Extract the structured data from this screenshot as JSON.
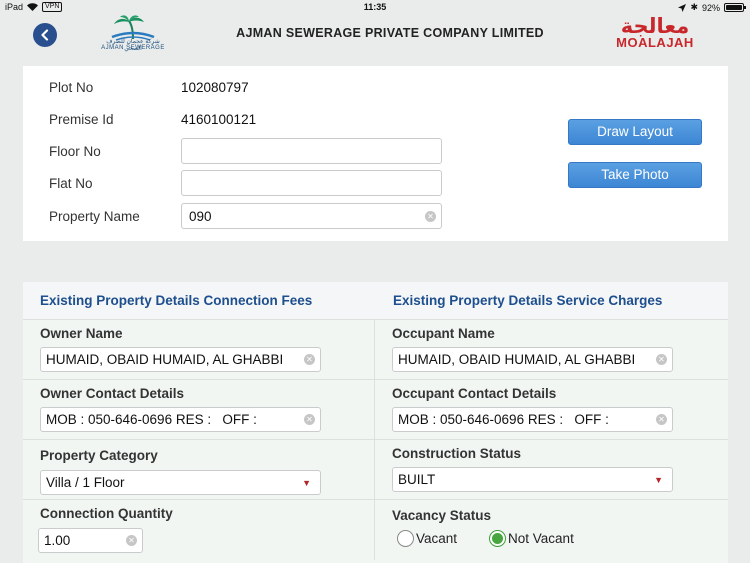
{
  "status": {
    "device": "iPad",
    "vpn": "VPN",
    "time": "11:35",
    "battery": "92%"
  },
  "header": {
    "title": "AJMAN SEWERAGE PRIVATE COMPANY LIMITED",
    "left_logo_arabic": "شركة عجمان للصرف الصحي",
    "left_logo_english": "AJMAN SEWERAGE",
    "right_logo_arabic": "معالجة",
    "right_logo_english": "MOALAJAH"
  },
  "form": {
    "plot_label": "Plot No",
    "plot_value": "102080797",
    "premise_label": "Premise Id",
    "premise_value": "4160100121",
    "floor_label": "Floor No",
    "floor_value": "",
    "flat_label": "Flat No",
    "flat_value": "",
    "property_name_label": "Property Name",
    "property_name_value": "090",
    "draw_layout": "Draw Layout",
    "take_photo": "Take Photo"
  },
  "details": {
    "left_heading": "Existing Property Details Connection Fees",
    "right_heading": "Existing Property Details Service Charges",
    "owner_name_label": "Owner Name",
    "owner_name_value": "HUMAID, OBAID HUMAID, AL GHABBI",
    "occupant_name_label": "Occupant Name",
    "occupant_name_value": "HUMAID, OBAID HUMAID, AL GHABBI",
    "owner_contact_label": "Owner Contact Details",
    "owner_contact_value": "MOB : 050-646-0696 RES :   OFF :",
    "occupant_contact_label": "Occupant Contact Details",
    "occupant_contact_value": "MOB : 050-646-0696 RES :   OFF :",
    "property_category_label": "Property Category",
    "property_category_value": "Villa / 1 Floor",
    "construction_status_label": "Construction Status",
    "construction_status_value": "BUILT",
    "connection_qty_label": "Connection Quantity",
    "connection_qty_value": "1.00",
    "vacancy_label": "Vacancy Status",
    "vacancy_options": [
      "Vacant",
      "Not Vacant"
    ],
    "vacancy_selected": "Not Vacant"
  },
  "colors": {
    "accent_blue": "#3d86d4",
    "heading_blue": "#1d4f8e",
    "brand_red": "#c8282c",
    "radio_green": "#47a63f"
  }
}
